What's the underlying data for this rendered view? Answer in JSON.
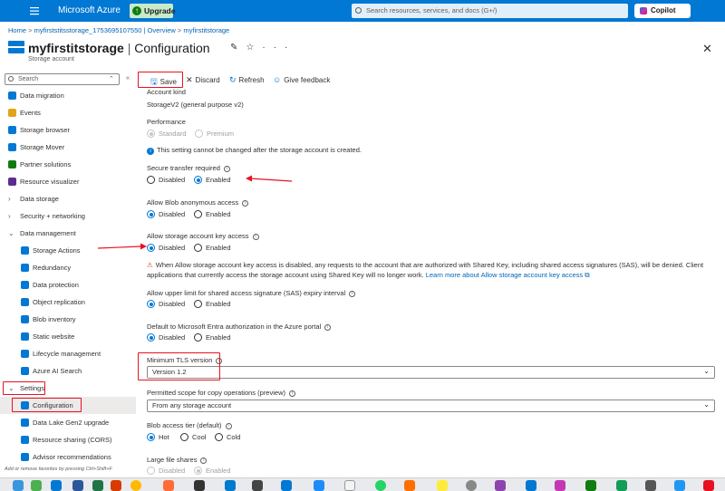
{
  "topbar": {
    "brand": "Microsoft Azure",
    "upgrade_label": "Upgrade",
    "search_placeholder": "Search resources, services, and docs (G+/)",
    "copilot_label": "Copilot",
    "brand_color": "#0078d4"
  },
  "breadcrumb": {
    "home": "Home",
    "sep": ">",
    "overview": "myfirststitsstorage_1753695107550 | Overview",
    "current": "myfirstitstorage"
  },
  "header": {
    "resource_name": "myfirstitstorage",
    "blade": "Configuration",
    "separator": "|",
    "subtitle": "Storage account",
    "close": "✕"
  },
  "sidebar": {
    "search_placeholder": "Search",
    "items": [
      {
        "label": "Data migration",
        "icon": "data-migration-icon",
        "color": "#0078d4"
      },
      {
        "label": "Events",
        "icon": "events-icon",
        "color": "#e3a21a"
      },
      {
        "label": "Storage browser",
        "icon": "storage-browser-icon",
        "color": "#0078d4"
      },
      {
        "label": "Storage Mover",
        "icon": "storage-mover-icon",
        "color": "#0078d4"
      },
      {
        "label": "Partner solutions",
        "icon": "partner-solutions-icon",
        "color": "#107c10"
      },
      {
        "label": "Resource visualizer",
        "icon": "resource-visualizer-icon",
        "color": "#5c2d91"
      },
      {
        "label": "Data storage",
        "chevron": "›"
      },
      {
        "label": "Security + networking",
        "chevron": "›"
      },
      {
        "label": "Data management",
        "chevron": "⌄"
      },
      {
        "label": "Storage Actions",
        "icon": "storage-actions-icon",
        "color": "#0078d4"
      },
      {
        "label": "Redundancy",
        "icon": "redundancy-icon",
        "color": "#0078d4"
      },
      {
        "label": "Data protection",
        "icon": "data-protection-icon",
        "color": "#0078d4"
      },
      {
        "label": "Object replication",
        "icon": "object-replication-icon",
        "color": "#0078d4"
      },
      {
        "label": "Blob inventory",
        "icon": "blob-inventory-icon",
        "color": "#0078d4"
      },
      {
        "label": "Static website",
        "icon": "static-website-icon",
        "color": "#0078d4"
      },
      {
        "label": "Lifecycle management",
        "icon": "lifecycle-icon",
        "color": "#0078d4"
      },
      {
        "label": "Azure AI Search",
        "icon": "ai-search-icon",
        "color": "#0078d4"
      },
      {
        "label": "Settings",
        "chevron": "⌄"
      },
      {
        "label": "Configuration",
        "icon": "configuration-icon",
        "color": "#0078d4",
        "selected": true
      },
      {
        "label": "Data Lake Gen2 upgrade",
        "icon": "datalake-icon",
        "color": "#0078d4"
      },
      {
        "label": "Resource sharing (CORS)",
        "icon": "cors-icon",
        "color": "#0078d4"
      },
      {
        "label": "Advisor recommendations",
        "icon": "advisor-icon",
        "color": "#0078d4"
      }
    ],
    "fav_hint": "Add or remove favorites by pressing Ctrl+Shift+F"
  },
  "toolbar": {
    "save": "Save",
    "discard": "Discard",
    "refresh": "Refresh",
    "feedback": "Give feedback"
  },
  "settings": {
    "account_kind_label": "Account kind",
    "account_kind_value": "StorageV2 (general purpose v2)",
    "performance_label": "Performance",
    "performance_standard": "Standard",
    "performance_premium": "Premium",
    "performance_note": "This setting cannot be changed after the storage account is created.",
    "secure_transfer_label": "Secure transfer required",
    "anon_access_label": "Allow Blob anonymous access",
    "key_access_label": "Allow storage account key access",
    "key_access_warning": "When Allow storage account key access is disabled, any requests to the account that are authorized with Shared Key, including shared access signatures (SAS), will be denied. Client applications that currently access the storage account using Shared Key will no longer work.",
    "key_access_link": "Learn more about Allow storage account key access",
    "sas_limit_label": "Allow upper limit for shared access signature (SAS) expiry interval",
    "entra_label": "Default to Microsoft Entra authorization in the Azure portal",
    "tls_label": "Minimum TLS version",
    "tls_value": "Version 1.2",
    "copy_scope_label": "Permitted scope for copy operations (preview)",
    "copy_scope_value": "From any storage account",
    "access_tier_label": "Blob access tier (default)",
    "tier_hot": "Hot",
    "tier_cool": "Cool",
    "tier_cold": "Cold",
    "large_file_label": "Large file shares",
    "disabled": "Disabled",
    "enabled": "Enabled"
  }
}
